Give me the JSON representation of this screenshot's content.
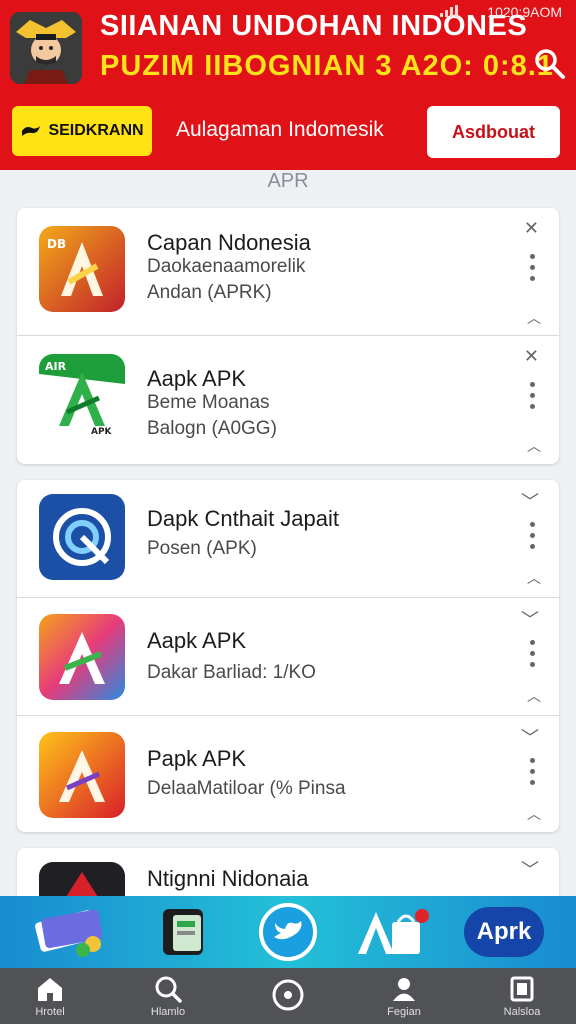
{
  "header": {
    "title_line1": "SIIANAN UNDOHAN INDONES",
    "title_line2": "PUZIM IIBOGNIAN 3 A2O: 0:8.1",
    "status_time": "1020:9AOM",
    "left_pill": "SEIDKRANN",
    "subtitle": "Aulagaman Indomesik",
    "right_pill": "Asdbouat",
    "colors": {
      "header_red": "#e01218",
      "yellow": "#ffe314"
    }
  },
  "section": {
    "title": "APR"
  },
  "apps": [
    {
      "name": "Capan Ndonesia",
      "line1": "Daokaenaamorelik",
      "line2": "Andan (APRK)",
      "icon": "apk-logo-orange-icon"
    },
    {
      "name": "Aapk APK",
      "line1": "Beme Moanas",
      "line2": "Balogn (A0GG)",
      "icon": "apk-logo-green-icon"
    },
    {
      "name": "Dapk Cnthait Japait",
      "line1": "Posen (APK)",
      "line2": "",
      "icon": "target-logo-blue-icon"
    },
    {
      "name": "Aapk APK",
      "line1": "Dakar Barliad: 1/KO",
      "line2": "",
      "icon": "apk-logo-rainbow-icon"
    },
    {
      "name": "Papk APK",
      "line1": "DelaaMatiloar (% Pinsa",
      "line2": "",
      "icon": "apk-logo-red-icon"
    },
    {
      "name": "Ntignni Nidonaia",
      "line1": "",
      "line2": "",
      "icon": "apk-logo-dark-icon"
    }
  ],
  "dock": {
    "items": [
      "card-wallet-icon",
      "phone-app-icon",
      "chat-bird-icon",
      "app-store-icon"
    ],
    "apk_label": "Aprk"
  },
  "bottom_nav": {
    "items": [
      {
        "label": "Hrotel",
        "icon": "home-icon"
      },
      {
        "label": "Hlamlo",
        "icon": "search-icon"
      },
      {
        "label": "",
        "icon": "circle-home-icon"
      },
      {
        "label": "Fegian",
        "icon": "person-icon"
      },
      {
        "label": "Nalsloa",
        "icon": "square-icon"
      }
    ]
  }
}
